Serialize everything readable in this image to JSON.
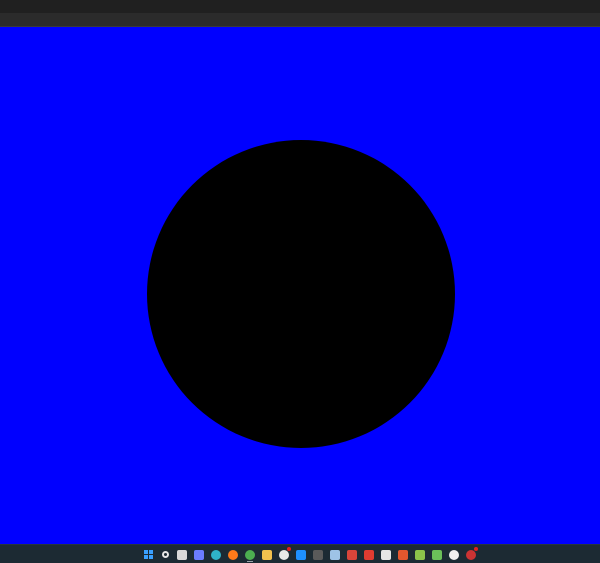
{
  "colors": {
    "canvas_background": "#0000ff",
    "circle_fill": "#000000"
  },
  "taskbar": {
    "icons": [
      {
        "name": "windows-start-icon",
        "color": "#3aa0ff"
      },
      {
        "name": "search-icon",
        "color": "#e6e6e6"
      },
      {
        "name": "task-view-icon",
        "color": "#d9d9d9"
      },
      {
        "name": "chat-icon",
        "color": "#6b7cff"
      },
      {
        "name": "edge-icon",
        "color": "#2fb3c9"
      },
      {
        "name": "firefox-icon",
        "color": "#ff7a1a"
      },
      {
        "name": "chrome-icon",
        "color": "#4caf50"
      },
      {
        "name": "file-explorer-icon",
        "color": "#f2c14e"
      },
      {
        "name": "app-badge-icon",
        "color": "#e8e8e8"
      },
      {
        "name": "vscode-icon",
        "color": "#1e90ff"
      },
      {
        "name": "terminal-icon",
        "color": "#5a5a5a"
      },
      {
        "name": "notepad-icon",
        "color": "#9ec3e6"
      },
      {
        "name": "app-m-icon",
        "color": "#d9453a"
      },
      {
        "name": "app-red-icon",
        "color": "#e03c31"
      },
      {
        "name": "notion-icon",
        "color": "#e6e6e6"
      },
      {
        "name": "app-orange-icon",
        "color": "#e4572e"
      },
      {
        "name": "app-green-icon",
        "color": "#8bc34a"
      },
      {
        "name": "app-lime-icon",
        "color": "#6bbf59"
      },
      {
        "name": "unreal-icon",
        "color": "#f0f0f0"
      },
      {
        "name": "app-notification-icon",
        "color": "#c33"
      }
    ]
  }
}
